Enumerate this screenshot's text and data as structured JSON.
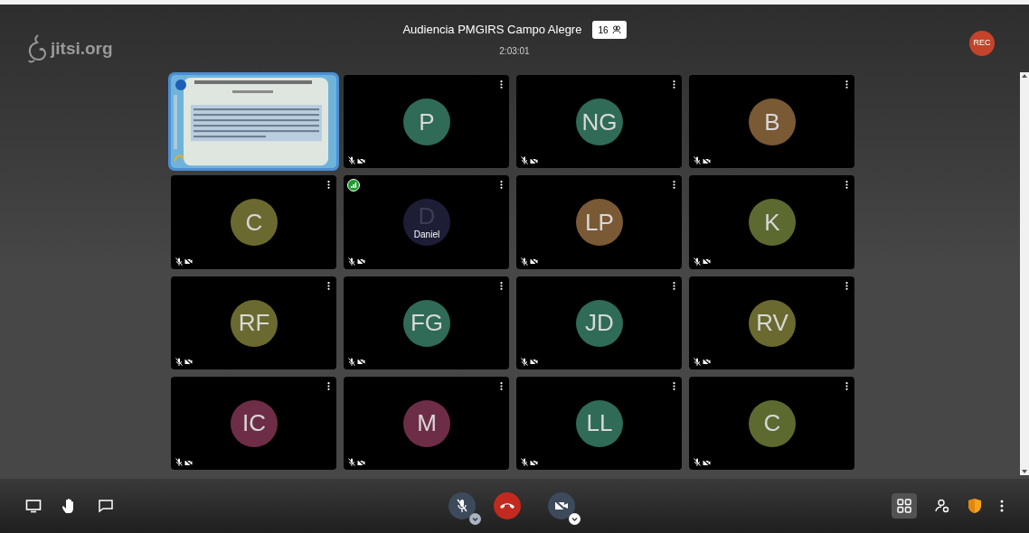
{
  "header": {
    "logo_text": "jitsi.org",
    "title": "Audiencia PMGIRS Campo Alegre",
    "duration": "2:03:01",
    "participant_count": "16",
    "recording_label": "REC"
  },
  "tiles": [
    {
      "kind": "screen",
      "selected": true
    },
    {
      "kind": "avatar",
      "initials": "P",
      "color": "#2f6b57",
      "selected": false
    },
    {
      "kind": "avatar",
      "initials": "NG",
      "color": "#2f6b57",
      "selected": false
    },
    {
      "kind": "avatar",
      "initials": "B",
      "color": "#7a5935",
      "selected": false
    },
    {
      "kind": "avatar",
      "initials": "C",
      "color": "#6a6a30",
      "selected": false
    },
    {
      "kind": "avatar",
      "initials": "D",
      "name": "Daniel",
      "color": "#1d1e36",
      "connection_indicator": true,
      "selected": false
    },
    {
      "kind": "avatar",
      "initials": "LP",
      "color": "#7a5935",
      "selected": false
    },
    {
      "kind": "avatar",
      "initials": "K",
      "color": "#5c6a30",
      "selected": false
    },
    {
      "kind": "avatar",
      "initials": "RF",
      "color": "#6a6a30",
      "selected": false
    },
    {
      "kind": "avatar",
      "initials": "FG",
      "color": "#2f6b57",
      "selected": false
    },
    {
      "kind": "avatar",
      "initials": "JD",
      "color": "#2f6b57",
      "selected": false
    },
    {
      "kind": "avatar",
      "initials": "RV",
      "color": "#6a6a30",
      "selected": false
    },
    {
      "kind": "avatar",
      "initials": "IC",
      "color": "#6e2d47",
      "selected": false
    },
    {
      "kind": "avatar",
      "initials": "M",
      "color": "#6e2d47",
      "selected": false
    },
    {
      "kind": "avatar",
      "initials": "LL",
      "color": "#2f6b57",
      "selected": false
    },
    {
      "kind": "avatar",
      "initials": "C",
      "color": "#5c6a30",
      "selected": false
    }
  ],
  "toolbar": {
    "microphone_muted": true,
    "camera_muted": true,
    "tile_view_selected": true
  }
}
